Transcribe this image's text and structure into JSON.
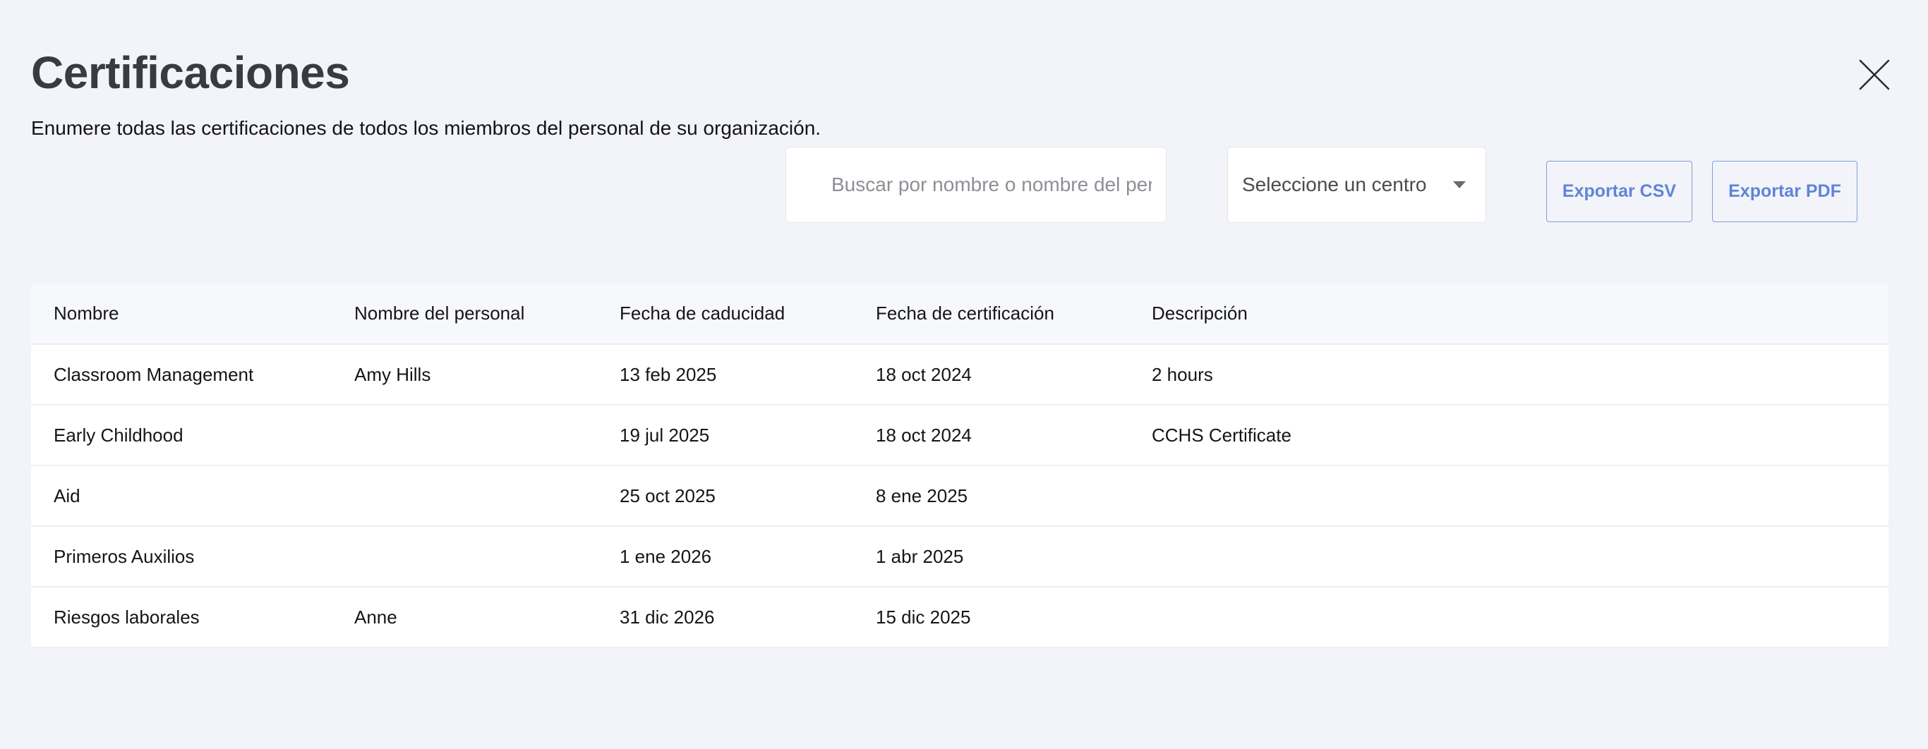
{
  "header": {
    "title": "Certificaciones",
    "subtitle": "Enumere todas las certificaciones de todos los miembros del personal de su organización."
  },
  "toolbar": {
    "search_placeholder": "Buscar por nombre o nombre del personal",
    "search_value": "",
    "center_select_value": "Seleccione un centro",
    "export_csv_label": "Exportar CSV",
    "export_pdf_label": "Exportar PDF"
  },
  "icons": {
    "close": "close-icon",
    "dropdown": "chevron-down-icon"
  },
  "colors": {
    "background": "#f3f4f9",
    "accent": "#5f84da",
    "title": "#3a3b40"
  },
  "table": {
    "columns": [
      "Nombre",
      "Nombre del personal",
      "Fecha de caducidad",
      "Fecha de certificación",
      "Descripción"
    ],
    "rows": [
      [
        "Classroom Management",
        "Amy Hills",
        "13 feb 2025",
        "18 oct 2024",
        "2 hours"
      ],
      [
        "Early Childhood",
        "",
        "19 jul 2025",
        "18 oct 2024",
        "CCHS Certificate"
      ],
      [
        "Aid",
        "",
        "25 oct 2025",
        "8 ene 2025",
        ""
      ],
      [
        "Primeros Auxilios",
        "",
        "1 ene 2026",
        "1 abr 2025",
        ""
      ],
      [
        "Riesgos laborales",
        "Anne",
        "31 dic 2026",
        "15 dic 2025",
        ""
      ]
    ]
  }
}
